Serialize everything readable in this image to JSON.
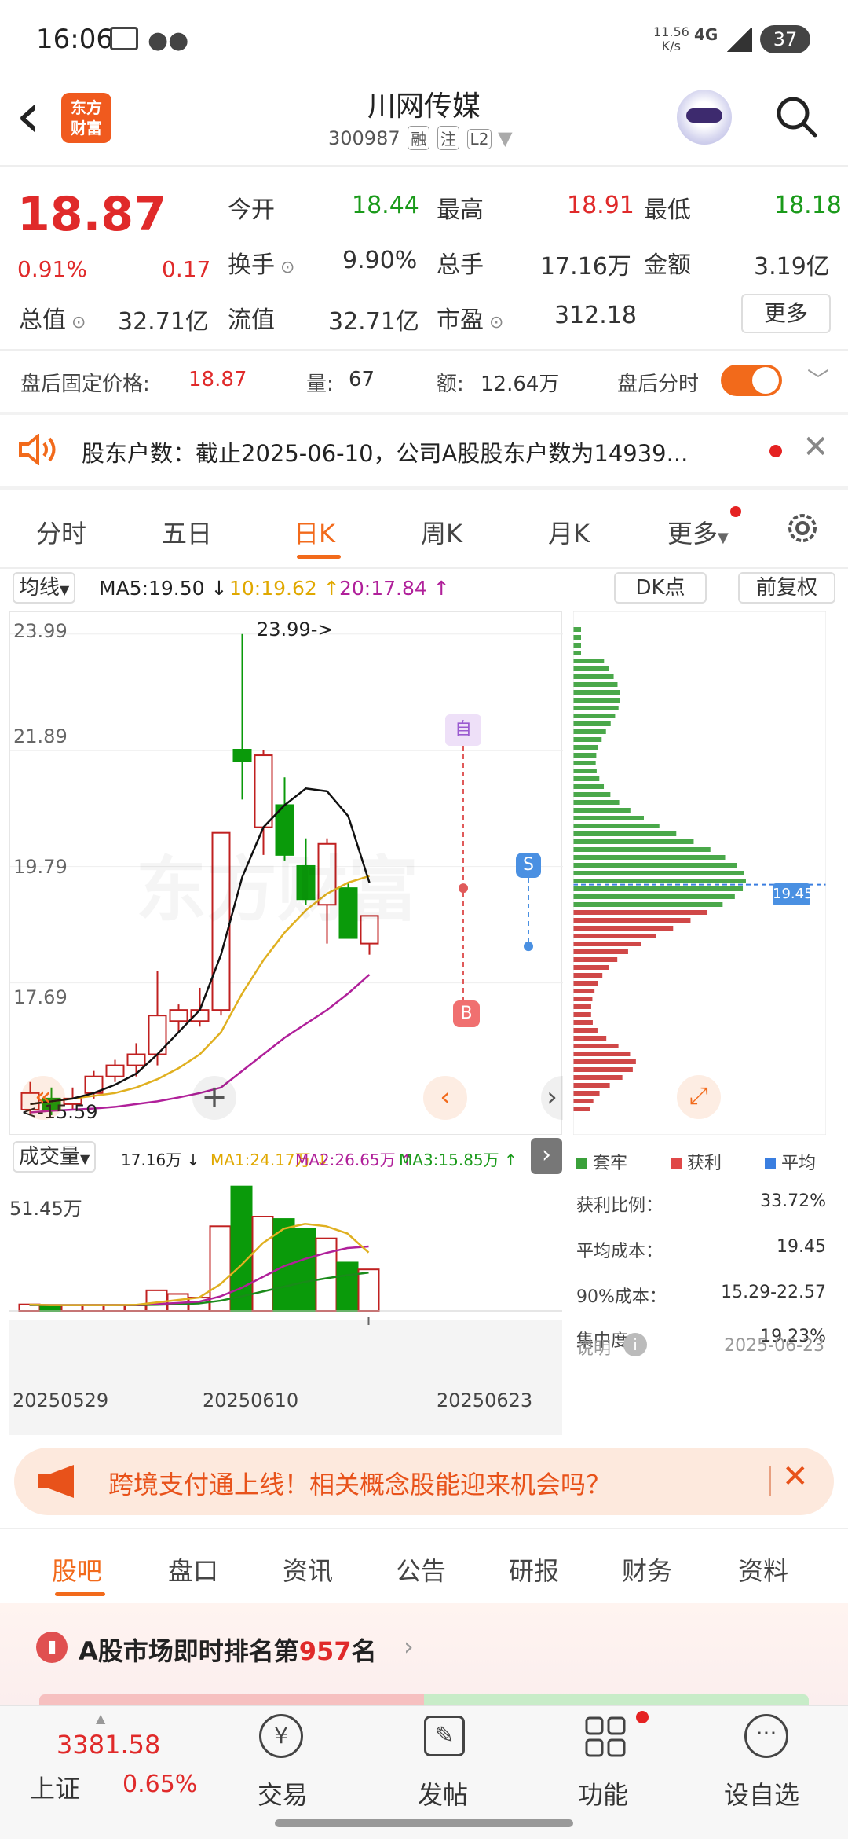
{
  "status_bar": {
    "time": "16:06",
    "net_speed_top": "11.56",
    "net_speed_bottom": "K/s",
    "network": "4G",
    "battery": "37"
  },
  "header": {
    "back": "‹",
    "logo_line1": "东方",
    "logo_line2": "财富",
    "stock_name": "川网传媒",
    "stock_code": "300987",
    "badges": [
      "融",
      "注",
      "L2"
    ]
  },
  "quote": {
    "price": "18.87",
    "change_pct": "0.91%",
    "change_amt": "0.17",
    "fields": [
      {
        "label": "今开",
        "value": "18.44"
      },
      {
        "label": "最高",
        "value": "18.91"
      },
      {
        "label": "最低",
        "value": "18.18"
      },
      {
        "label": "换手",
        "value": "9.90%"
      },
      {
        "label": "总手",
        "value": "17.16万"
      },
      {
        "label": "金额",
        "value": "3.19亿"
      },
      {
        "label": "总值",
        "value": "32.71亿"
      },
      {
        "label": "流值",
        "value": "32.71亿"
      },
      {
        "label": "市盈",
        "value": "312.18"
      }
    ],
    "more": "更多"
  },
  "after_hours": {
    "price_label": "盘后固定价格:",
    "price": "18.87",
    "vol_label": "量:",
    "vol": "67",
    "amt_label": "额:",
    "amt": "12.64万",
    "toggle_label": "盘后分时"
  },
  "notice": {
    "text": "股东户数：截止2025-06-10，公司A股股东户数为14939..."
  },
  "chart_tabs": [
    "分时",
    "五日",
    "日K",
    "周K",
    "月K",
    "更多"
  ],
  "indicator_bar": {
    "ma_type": "均线",
    "ma5": "MA5:19.50",
    "ma10": "10:19.62",
    "ma20": "20:17.84",
    "dk": "DK点",
    "fq": "前复权"
  },
  "kline": {
    "y_labels": [
      "23.99",
      "21.89",
      "19.79",
      "17.69"
    ],
    "max_label": "23.99->",
    "min_label": "<-15.59",
    "marker_auto": "自",
    "marker_b": "B",
    "marker_s": "S",
    "chip_price": "19.45",
    "watermark": "东方财富"
  },
  "volume": {
    "label": "成交量",
    "vol": "17.16万",
    "ma1": "MA1:24.17万",
    "ma2": "MA2:26.65万",
    "ma3": "MA3:15.85万",
    "top_label": "51.45万",
    "dates": [
      "20250529",
      "20250610",
      "20250623"
    ]
  },
  "chip_panel": {
    "legend": [
      {
        "label": "套牢",
        "color": "#3aa03a"
      },
      {
        "label": "获利",
        "color": "#e04848"
      },
      {
        "label": "平均",
        "color": "#3a7ee0"
      }
    ],
    "rows": [
      {
        "label": "获利比例：",
        "value": "33.72%"
      },
      {
        "label": "平均成本：",
        "value": "19.45"
      },
      {
        "label": "90%成本：",
        "value": "15.29-22.57"
      },
      {
        "label": "集中度：",
        "value": "19.23%"
      }
    ],
    "note_label": "说明",
    "note_date": "2025-06-23"
  },
  "ad": {
    "text": "跨境支付通上线！相关概念股能迎来机会吗？"
  },
  "bottom_tabs": [
    "股吧",
    "盘口",
    "资讯",
    "公告",
    "研报",
    "财务",
    "资料"
  ],
  "rank": {
    "prefix": "A股市场即时排名第",
    "num": "957",
    "suffix": "名"
  },
  "bottom_nav": {
    "index_value": "3381.58",
    "index_name": "上证",
    "index_change": "0.65%",
    "items": [
      "交易",
      "发帖",
      "功能",
      "设自选"
    ]
  },
  "chart_data": {
    "type": "candlestick",
    "y_range": [
      15.59,
      23.99
    ],
    "candles": [
      {
        "o": 15.4,
        "h": 15.9,
        "l": 15.3,
        "c": 15.7
      },
      {
        "o": 15.6,
        "h": 15.8,
        "l": 15.3,
        "c": 15.4
      },
      {
        "o": 15.5,
        "h": 15.8,
        "l": 15.4,
        "c": 15.6
      },
      {
        "o": 15.7,
        "h": 16.1,
        "l": 15.6,
        "c": 16.0
      },
      {
        "o": 16.0,
        "h": 16.3,
        "l": 15.9,
        "c": 16.2
      },
      {
        "o": 16.2,
        "h": 16.6,
        "l": 16.0,
        "c": 16.4
      },
      {
        "o": 16.4,
        "h": 17.9,
        "l": 16.2,
        "c": 17.1
      },
      {
        "o": 17.0,
        "h": 17.3,
        "l": 16.8,
        "c": 17.2
      },
      {
        "o": 17.0,
        "h": 17.6,
        "l": 16.9,
        "c": 17.2
      },
      {
        "o": 17.2,
        "h": 20.4,
        "l": 17.1,
        "c": 20.4
      },
      {
        "o": 21.9,
        "h": 23.99,
        "l": 21.0,
        "c": 21.7
      },
      {
        "o": 20.5,
        "h": 21.9,
        "l": 20.0,
        "c": 21.8
      },
      {
        "o": 20.9,
        "h": 21.4,
        "l": 19.9,
        "c": 20.0
      },
      {
        "o": 19.8,
        "h": 20.3,
        "l": 19.1,
        "c": 19.2
      },
      {
        "o": 19.1,
        "h": 20.3,
        "l": 18.4,
        "c": 20.2
      },
      {
        "o": 19.4,
        "h": 19.5,
        "l": 18.5,
        "c": 18.5
      },
      {
        "o": 18.4,
        "h": 18.9,
        "l": 18.2,
        "c": 18.9
      }
    ],
    "ma5": [
      15.5,
      15.55,
      15.6,
      15.7,
      15.85,
      16.05,
      16.4,
      16.8,
      17.2,
      18.2,
      19.6,
      20.5,
      20.9,
      21.2,
      21.15,
      20.7,
      19.5
    ],
    "ma10": [
      15.5,
      15.55,
      15.6,
      15.65,
      15.7,
      15.8,
      15.95,
      16.15,
      16.4,
      16.8,
      17.5,
      18.1,
      18.6,
      19.0,
      19.3,
      19.5,
      19.62
    ],
    "ma20": [
      15.35,
      15.38,
      15.4,
      15.42,
      15.45,
      15.5,
      15.55,
      15.62,
      15.7,
      15.8,
      16.1,
      16.4,
      16.7,
      16.95,
      17.2,
      17.5,
      17.84
    ],
    "volumes": [
      2.7,
      1.8,
      2.4,
      2.5,
      2.5,
      2.3,
      8.5,
      7.0,
      5.5,
      35.0,
      51.45,
      39.0,
      38.0,
      34.0,
      30.0,
      20.0,
      17.16
    ],
    "vol_ma1": [
      2.6,
      2.4,
      2.4,
      2.4,
      2.4,
      2.5,
      3.5,
      4.5,
      5.5,
      11,
      19,
      28,
      34,
      36,
      35,
      32,
      24.17
    ],
    "vol_ma2": [
      2.5,
      2.45,
      2.42,
      2.42,
      2.44,
      2.45,
      2.8,
      3.3,
      3.8,
      6,
      9.5,
      14,
      18.5,
      21.5,
      24,
      26,
      26.65
    ],
    "vol_ma3": [
      2.4,
      2.4,
      2.4,
      2.4,
      2.4,
      2.4,
      2.5,
      2.8,
      3.1,
      4.2,
      6,
      8,
      10,
      12,
      13.5,
      14.8,
      15.85
    ]
  }
}
